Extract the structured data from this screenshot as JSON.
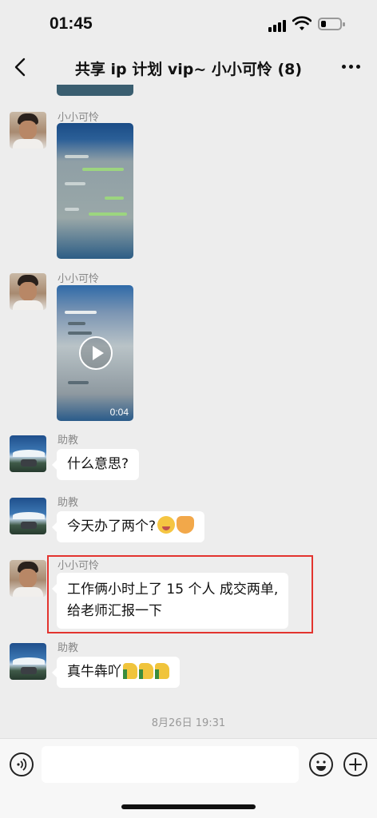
{
  "status_bar": {
    "time": "01:45"
  },
  "nav": {
    "title": "共享 ip 计划 vip~ 小小可怜 (8)"
  },
  "messages": [
    {
      "sender": "小小可怜",
      "type": "image"
    },
    {
      "sender": "小小可怜",
      "type": "video",
      "duration": "0:04"
    },
    {
      "sender": "助教",
      "type": "text",
      "text": "什么意思?"
    },
    {
      "sender": "助教",
      "type": "text",
      "text": "今天办了两个?",
      "emoji": [
        "drooling-face-emoji",
        "cat-face-emoji"
      ]
    },
    {
      "sender": "小小可怜",
      "type": "text",
      "lines": [
        "工作俩小时上了 15 个人 成交两单,",
        "给老师汇报一下"
      ],
      "highlighted": true
    },
    {
      "sender": "助教",
      "type": "text",
      "text": "真牛犇吖",
      "emoji": [
        "thumbs-up-emoji",
        "thumbs-up-emoji",
        "thumbs-up-emoji"
      ]
    }
  ],
  "timestamp": "8月26日 19:31",
  "colors": {
    "background": "#ededed",
    "bubble": "#ffffff",
    "highlight_border": "#e3342f"
  }
}
